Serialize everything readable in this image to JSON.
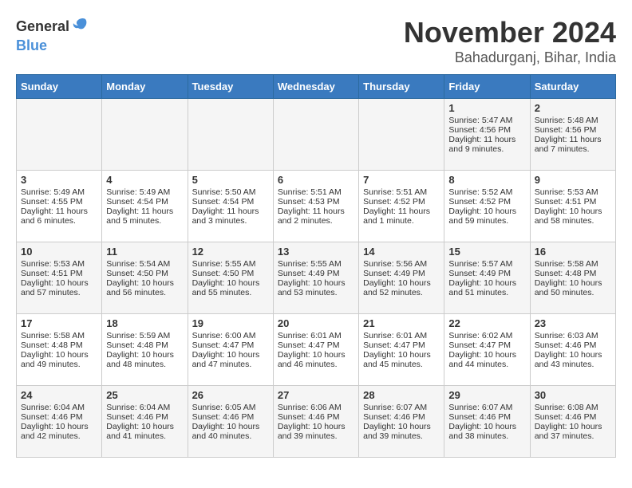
{
  "logo": {
    "general": "General",
    "blue": "Blue"
  },
  "title": "November 2024",
  "location": "Bahadurganj, Bihar, India",
  "headers": [
    "Sunday",
    "Monday",
    "Tuesday",
    "Wednesday",
    "Thursday",
    "Friday",
    "Saturday"
  ],
  "weeks": [
    [
      {
        "day": "",
        "info": ""
      },
      {
        "day": "",
        "info": ""
      },
      {
        "day": "",
        "info": ""
      },
      {
        "day": "",
        "info": ""
      },
      {
        "day": "",
        "info": ""
      },
      {
        "day": "1",
        "info": "Sunrise: 5:47 AM\nSunset: 4:56 PM\nDaylight: 11 hours and 9 minutes."
      },
      {
        "day": "2",
        "info": "Sunrise: 5:48 AM\nSunset: 4:56 PM\nDaylight: 11 hours and 7 minutes."
      }
    ],
    [
      {
        "day": "3",
        "info": "Sunrise: 5:49 AM\nSunset: 4:55 PM\nDaylight: 11 hours and 6 minutes."
      },
      {
        "day": "4",
        "info": "Sunrise: 5:49 AM\nSunset: 4:54 PM\nDaylight: 11 hours and 5 minutes."
      },
      {
        "day": "5",
        "info": "Sunrise: 5:50 AM\nSunset: 4:54 PM\nDaylight: 11 hours and 3 minutes."
      },
      {
        "day": "6",
        "info": "Sunrise: 5:51 AM\nSunset: 4:53 PM\nDaylight: 11 hours and 2 minutes."
      },
      {
        "day": "7",
        "info": "Sunrise: 5:51 AM\nSunset: 4:52 PM\nDaylight: 11 hours and 1 minute."
      },
      {
        "day": "8",
        "info": "Sunrise: 5:52 AM\nSunset: 4:52 PM\nDaylight: 10 hours and 59 minutes."
      },
      {
        "day": "9",
        "info": "Sunrise: 5:53 AM\nSunset: 4:51 PM\nDaylight: 10 hours and 58 minutes."
      }
    ],
    [
      {
        "day": "10",
        "info": "Sunrise: 5:53 AM\nSunset: 4:51 PM\nDaylight: 10 hours and 57 minutes."
      },
      {
        "day": "11",
        "info": "Sunrise: 5:54 AM\nSunset: 4:50 PM\nDaylight: 10 hours and 56 minutes."
      },
      {
        "day": "12",
        "info": "Sunrise: 5:55 AM\nSunset: 4:50 PM\nDaylight: 10 hours and 55 minutes."
      },
      {
        "day": "13",
        "info": "Sunrise: 5:55 AM\nSunset: 4:49 PM\nDaylight: 10 hours and 53 minutes."
      },
      {
        "day": "14",
        "info": "Sunrise: 5:56 AM\nSunset: 4:49 PM\nDaylight: 10 hours and 52 minutes."
      },
      {
        "day": "15",
        "info": "Sunrise: 5:57 AM\nSunset: 4:49 PM\nDaylight: 10 hours and 51 minutes."
      },
      {
        "day": "16",
        "info": "Sunrise: 5:58 AM\nSunset: 4:48 PM\nDaylight: 10 hours and 50 minutes."
      }
    ],
    [
      {
        "day": "17",
        "info": "Sunrise: 5:58 AM\nSunset: 4:48 PM\nDaylight: 10 hours and 49 minutes."
      },
      {
        "day": "18",
        "info": "Sunrise: 5:59 AM\nSunset: 4:48 PM\nDaylight: 10 hours and 48 minutes."
      },
      {
        "day": "19",
        "info": "Sunrise: 6:00 AM\nSunset: 4:47 PM\nDaylight: 10 hours and 47 minutes."
      },
      {
        "day": "20",
        "info": "Sunrise: 6:01 AM\nSunset: 4:47 PM\nDaylight: 10 hours and 46 minutes."
      },
      {
        "day": "21",
        "info": "Sunrise: 6:01 AM\nSunset: 4:47 PM\nDaylight: 10 hours and 45 minutes."
      },
      {
        "day": "22",
        "info": "Sunrise: 6:02 AM\nSunset: 4:47 PM\nDaylight: 10 hours and 44 minutes."
      },
      {
        "day": "23",
        "info": "Sunrise: 6:03 AM\nSunset: 4:46 PM\nDaylight: 10 hours and 43 minutes."
      }
    ],
    [
      {
        "day": "24",
        "info": "Sunrise: 6:04 AM\nSunset: 4:46 PM\nDaylight: 10 hours and 42 minutes."
      },
      {
        "day": "25",
        "info": "Sunrise: 6:04 AM\nSunset: 4:46 PM\nDaylight: 10 hours and 41 minutes."
      },
      {
        "day": "26",
        "info": "Sunrise: 6:05 AM\nSunset: 4:46 PM\nDaylight: 10 hours and 40 minutes."
      },
      {
        "day": "27",
        "info": "Sunrise: 6:06 AM\nSunset: 4:46 PM\nDaylight: 10 hours and 39 minutes."
      },
      {
        "day": "28",
        "info": "Sunrise: 6:07 AM\nSunset: 4:46 PM\nDaylight: 10 hours and 39 minutes."
      },
      {
        "day": "29",
        "info": "Sunrise: 6:07 AM\nSunset: 4:46 PM\nDaylight: 10 hours and 38 minutes."
      },
      {
        "day": "30",
        "info": "Sunrise: 6:08 AM\nSunset: 4:46 PM\nDaylight: 10 hours and 37 minutes."
      }
    ]
  ]
}
